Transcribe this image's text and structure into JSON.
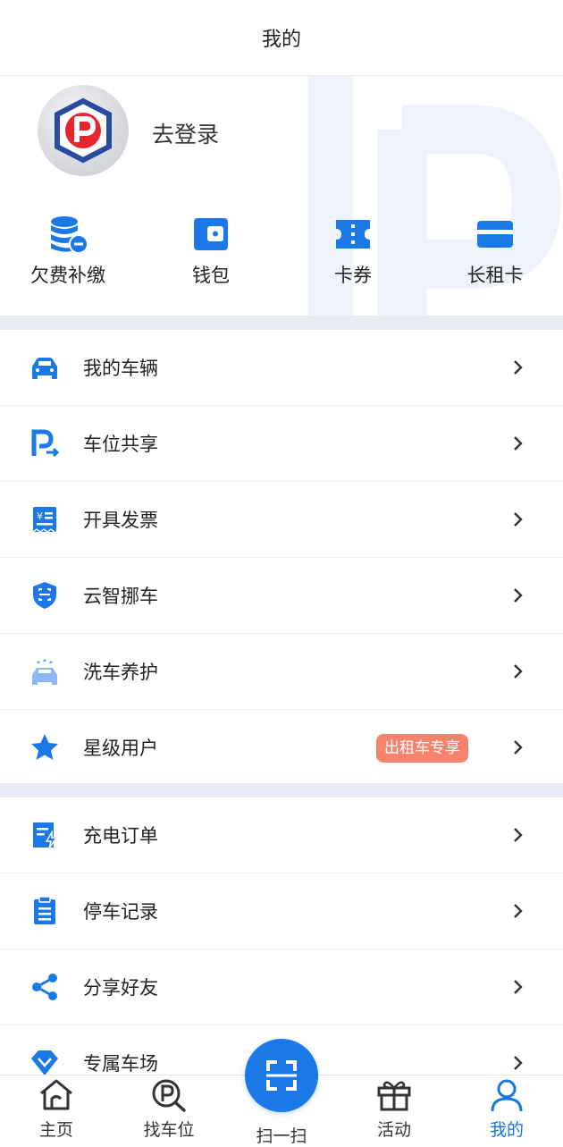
{
  "header": {
    "title": "我的"
  },
  "profile": {
    "login_text": "去登录"
  },
  "quick_actions": [
    {
      "label": "欠费补缴",
      "icon": "arrears-payment-icon"
    },
    {
      "label": "钱包",
      "icon": "wallet-icon"
    },
    {
      "label": "卡券",
      "icon": "coupon-icon"
    },
    {
      "label": "长租卡",
      "icon": "card-icon"
    }
  ],
  "menu_group_1": [
    {
      "label": "我的车辆",
      "icon": "car-icon"
    },
    {
      "label": "车位共享",
      "icon": "parking-share-icon"
    },
    {
      "label": "开具发票",
      "icon": "invoice-icon"
    },
    {
      "label": "云智挪车",
      "icon": "shield-car-icon"
    },
    {
      "label": "洗车养护",
      "icon": "car-wash-icon"
    },
    {
      "label": "星级用户",
      "icon": "star-icon",
      "badge": "出租车专享"
    }
  ],
  "menu_group_2": [
    {
      "label": "充电订单",
      "icon": "charging-order-icon"
    },
    {
      "label": "停车记录",
      "icon": "clipboard-icon"
    },
    {
      "label": "分享好友",
      "icon": "share-icon"
    },
    {
      "label": "专属车场",
      "icon": "diamond-icon"
    }
  ],
  "tabbar": {
    "home": "主页",
    "find_parking": "找车位",
    "scan": "扫一扫",
    "activity": "活动",
    "mine": "我的"
  },
  "colors": {
    "accent": "#1677e6",
    "badge": "#f6836e",
    "separator": "#e8ecf2"
  }
}
